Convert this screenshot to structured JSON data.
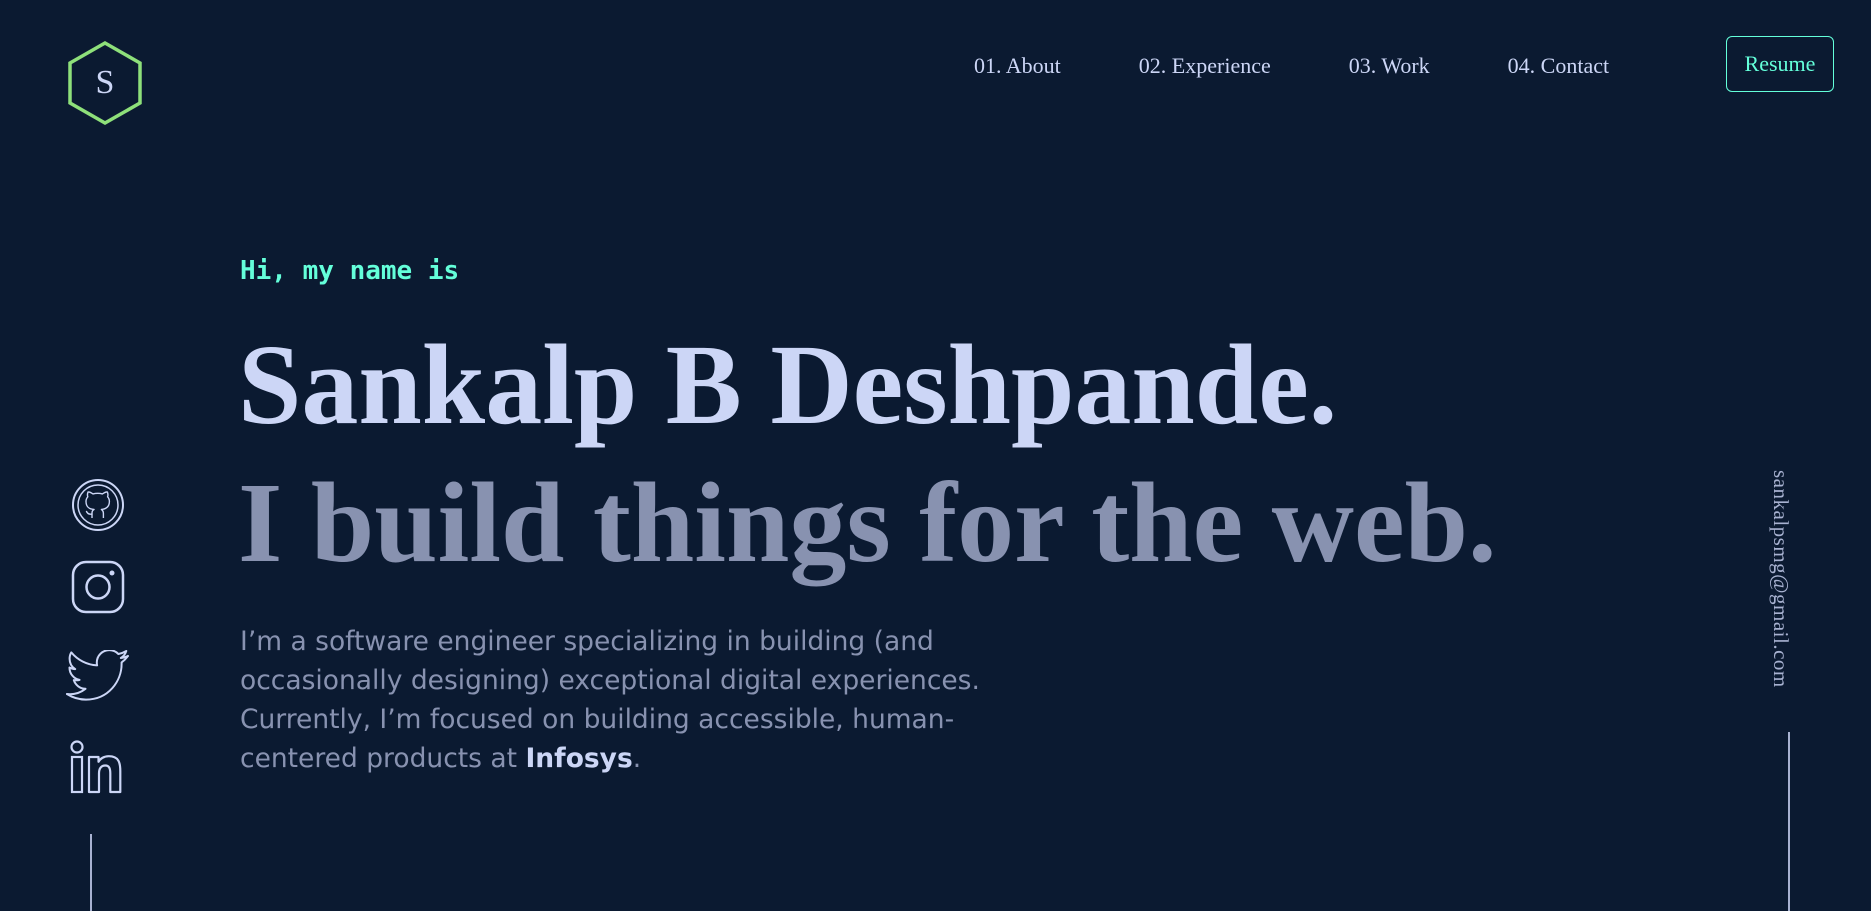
{
  "logo": {
    "letter": "S"
  },
  "nav": {
    "items": [
      {
        "label": "01. About"
      },
      {
        "label": "02. Experience"
      },
      {
        "label": "03. Work"
      },
      {
        "label": "04. Contact"
      }
    ],
    "resume_label": "Resume"
  },
  "hero": {
    "greeting": "Hi, my name is",
    "name": "Sankalp B Deshpande.",
    "tagline": "I build things for the web.",
    "bio_text": "I’m a software engineer specializing in building (and occasionally designing) exceptional digital experiences. Currently, I’m focused on building accessible, human-centered products at ",
    "bio_company": "Infosys",
    "bio_end": "."
  },
  "social": {
    "icons": [
      "github-icon",
      "instagram-icon",
      "twitter-icon",
      "linkedin-icon"
    ]
  },
  "email": {
    "address": "sankalpsmg@gmail.com"
  },
  "colors": {
    "background": "#0b1a31",
    "accent": "#64ffda",
    "logo_stroke": "#8ee07a",
    "heading": "#ccd6f6",
    "muted": "#8892b0",
    "icon": "#ccd6f6"
  }
}
